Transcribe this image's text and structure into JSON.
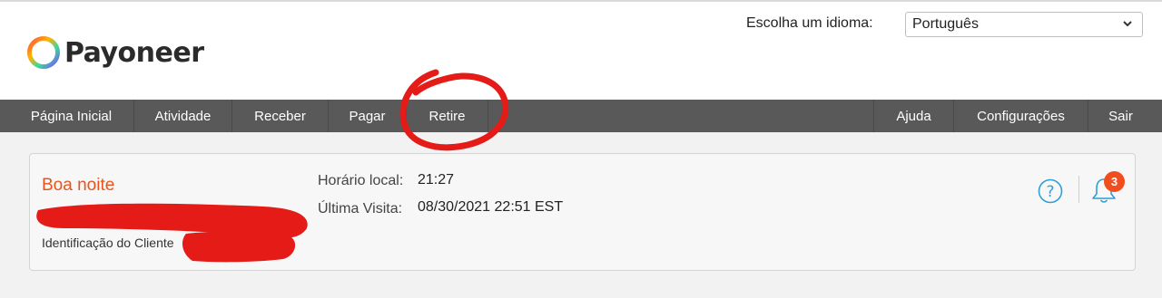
{
  "header": {
    "brand": "Payoneer",
    "language_label": "Escolha um idioma:",
    "language_selected": "Português"
  },
  "nav": {
    "left": [
      "Página Inicial",
      "Atividade",
      "Receber",
      "Pagar",
      "Retire"
    ],
    "right": [
      "Ajuda",
      "Configurações",
      "Sair"
    ]
  },
  "account": {
    "greeting": "Boa noite",
    "client_id_label": "Identificação do Cliente",
    "local_time_label": "Horário local:",
    "local_time_value": "21:27",
    "last_visit_label": "Última Visita:",
    "last_visit_value": "08/30/2021 22:51 EST",
    "notification_count": "3"
  },
  "colors": {
    "accent": "#e8541c",
    "navbar": "#595959",
    "annotation_red": "#e41b17",
    "icon_blue": "#2f9fd8"
  },
  "icons": [
    "payoneer-logo-ring",
    "chevron-down-icon",
    "help-icon",
    "bell-icon"
  ]
}
